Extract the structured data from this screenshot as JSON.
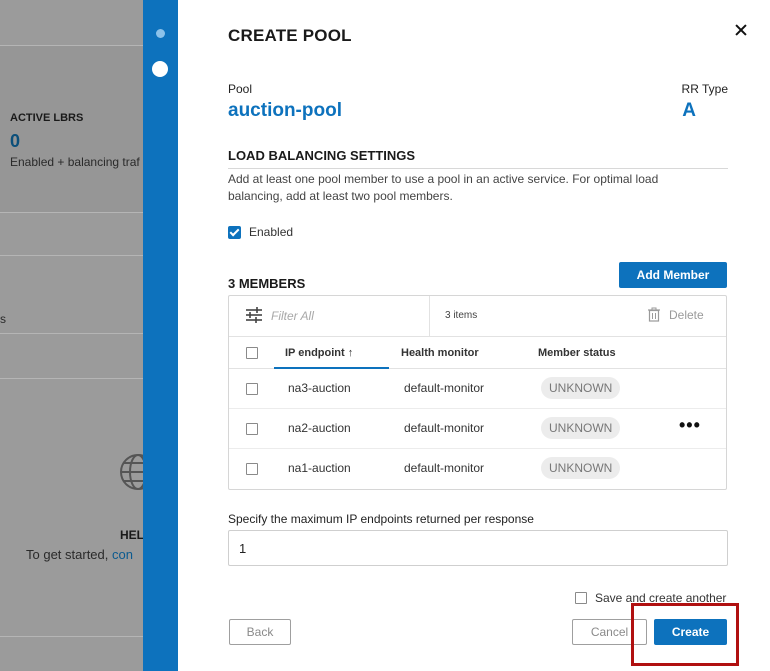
{
  "background": {
    "active_lbrs_title": "ACTIVE LBRS",
    "active_lbrs_count": "0",
    "active_lbrs_desc": "Enabled + balancing traf",
    "side_text": "s",
    "help_title": "HEL",
    "help_desc": "To get started, ",
    "help_link": "con"
  },
  "modal": {
    "title": "CREATE POOL",
    "close_icon": "close-icon",
    "pool_label": "Pool",
    "pool_name": "auction-pool",
    "rr_label": "RR Type",
    "rr_value": "A"
  },
  "lb_settings": {
    "title": "LOAD BALANCING SETTINGS",
    "description": "Add at least one pool member to use a pool in an active service. For optimal load balancing, add at least two pool members.",
    "enabled_label": "Enabled",
    "enabled_checked": true
  },
  "members": {
    "title": "3 MEMBERS",
    "add_button": "Add Member",
    "filter_placeholder": "Filter All",
    "items_count": "3 items",
    "delete_label": "Delete",
    "columns": {
      "ip_endpoint": "IP endpoint",
      "sort_arrow": "↑",
      "health_monitor": "Health monitor",
      "member_status": "Member status"
    },
    "rows": [
      {
        "ip": "na3-auction",
        "monitor": "default-monitor",
        "status": "UNKNOWN"
      },
      {
        "ip": "na2-auction",
        "monitor": "default-monitor",
        "status": "UNKNOWN",
        "menu": "•••"
      },
      {
        "ip": "na1-auction",
        "monitor": "default-monitor",
        "status": "UNKNOWN"
      }
    ]
  },
  "max_endpoints": {
    "label": "Specify the maximum IP endpoints returned per response",
    "value": "1"
  },
  "footer": {
    "save_another_label": "Save and create another",
    "back": "Back",
    "cancel": "Cancel",
    "create": "Create"
  },
  "colors": {
    "accent": "#0d72bd",
    "highlight": "#b01010"
  }
}
